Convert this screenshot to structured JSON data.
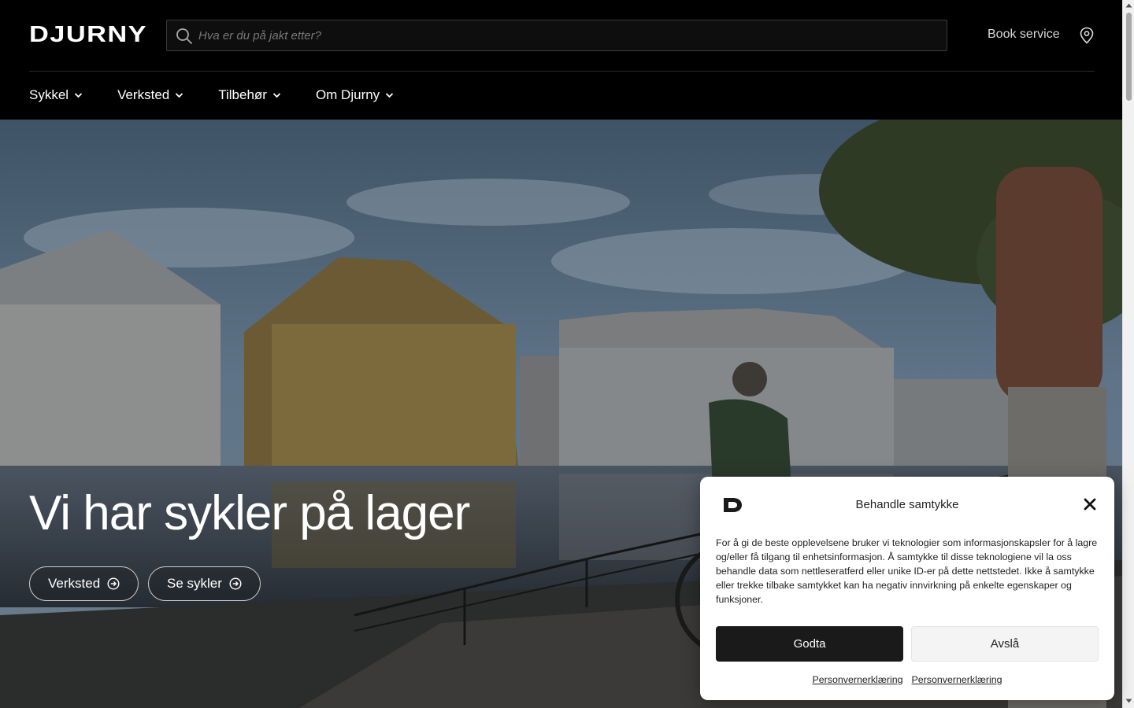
{
  "header": {
    "logo_text": "DJURNY",
    "search_placeholder": "Hva er du på jakt etter?",
    "book_service": "Book service",
    "icons": [
      "search-icon",
      "location-pin-icon"
    ]
  },
  "nav": {
    "items": [
      {
        "label": "Sykkel"
      },
      {
        "label": "Verksted"
      },
      {
        "label": "Tilbehør"
      },
      {
        "label": "Om Djurny"
      }
    ]
  },
  "hero": {
    "title": "Vi har sykler på lager",
    "buttons": [
      {
        "label": "Verksted"
      },
      {
        "label": "Se sykler"
      }
    ]
  },
  "consent": {
    "title": "Behandle samtykke",
    "text": "For å gi de beste opplevelsene bruker vi teknologier som informasjonskapsler for å lagre og/eller få tilgang til enhetsinformasjon. Å samtykke til disse teknologiene vil la oss behandle data som nettleseratferd eller unike ID-er på dette nettstedet. Ikke å samtykke eller trekke tilbake samtykket kan ha negativ innvirkning på enkelte egenskaper og funksjoner.",
    "accept_label": "Godta",
    "deny_label": "Avslå",
    "links": [
      "Personvernerklæring",
      "Personvernerklæring"
    ]
  },
  "colors": {
    "header_bg": "#000000",
    "accept_bg": "#1a1a1a",
    "deny_bg": "#f4f4f4",
    "text_on_dark": "#ffffff"
  }
}
